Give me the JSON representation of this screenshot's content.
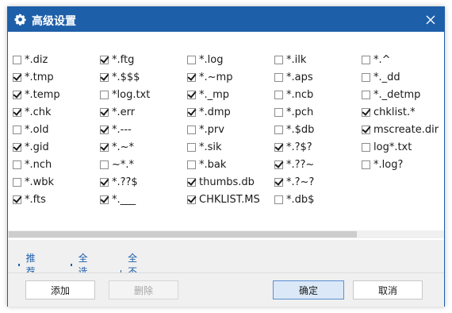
{
  "window": {
    "title": "高级设置",
    "close_icon": "close-icon",
    "gear_icon": "gear-icon",
    "accent": "#1e5fa9"
  },
  "columns": [
    [
      {
        "label": "*.diz",
        "checked": false
      },
      {
        "label": "*.tmp",
        "checked": true
      },
      {
        "label": "*.temp",
        "checked": true
      },
      {
        "label": "*.chk",
        "checked": true
      },
      {
        "label": "*.old",
        "checked": false
      },
      {
        "label": "*.gid",
        "checked": true
      },
      {
        "label": "*.nch",
        "checked": false
      },
      {
        "label": "*.wbk",
        "checked": false
      },
      {
        "label": "*.fts",
        "checked": true
      }
    ],
    [
      {
        "label": "*.ftg",
        "checked": true
      },
      {
        "label": "*.$$$",
        "checked": true
      },
      {
        "label": "*log.txt",
        "checked": false
      },
      {
        "label": "*.err",
        "checked": true
      },
      {
        "label": "*.---",
        "checked": true
      },
      {
        "label": "*.~*",
        "checked": true
      },
      {
        "label": "~*.*",
        "checked": false
      },
      {
        "label": "*.??$",
        "checked": true
      },
      {
        "label": "*.___",
        "checked": true
      }
    ],
    [
      {
        "label": "*.log",
        "checked": false
      },
      {
        "label": "*.~mp",
        "checked": true
      },
      {
        "label": "*._mp",
        "checked": true
      },
      {
        "label": "*.dmp",
        "checked": true
      },
      {
        "label": "*.prv",
        "checked": false
      },
      {
        "label": "*.sik",
        "checked": false
      },
      {
        "label": "*.bak",
        "checked": false
      },
      {
        "label": "thumbs.db",
        "checked": true
      },
      {
        "label": "CHKLIST.MS",
        "checked": true
      }
    ],
    [
      {
        "label": "*.ilk",
        "checked": false
      },
      {
        "label": "*.aps",
        "checked": false
      },
      {
        "label": "*.ncb",
        "checked": false
      },
      {
        "label": "*.pch",
        "checked": false
      },
      {
        "label": "*.$db",
        "checked": false
      },
      {
        "label": "*.?$?",
        "checked": true
      },
      {
        "label": "*.??~",
        "checked": true
      },
      {
        "label": "*.?~?",
        "checked": true
      },
      {
        "label": "*.db$",
        "checked": false
      }
    ],
    [
      {
        "label": "*.^",
        "checked": false
      },
      {
        "label": "*._dd",
        "checked": false
      },
      {
        "label": "*._detmp",
        "checked": false
      },
      {
        "label": "chklist.*",
        "checked": true
      },
      {
        "label": "mscreate.dir",
        "checked": true
      },
      {
        "label": "log*.txt",
        "checked": false
      },
      {
        "label": "*.log?",
        "checked": false
      }
    ]
  ],
  "links": {
    "recommend": "推荐",
    "select_all": "全选",
    "select_none": "全不选"
  },
  "buttons": {
    "add": "添加",
    "delete": "删除",
    "ok": "确定",
    "cancel": "取消"
  }
}
